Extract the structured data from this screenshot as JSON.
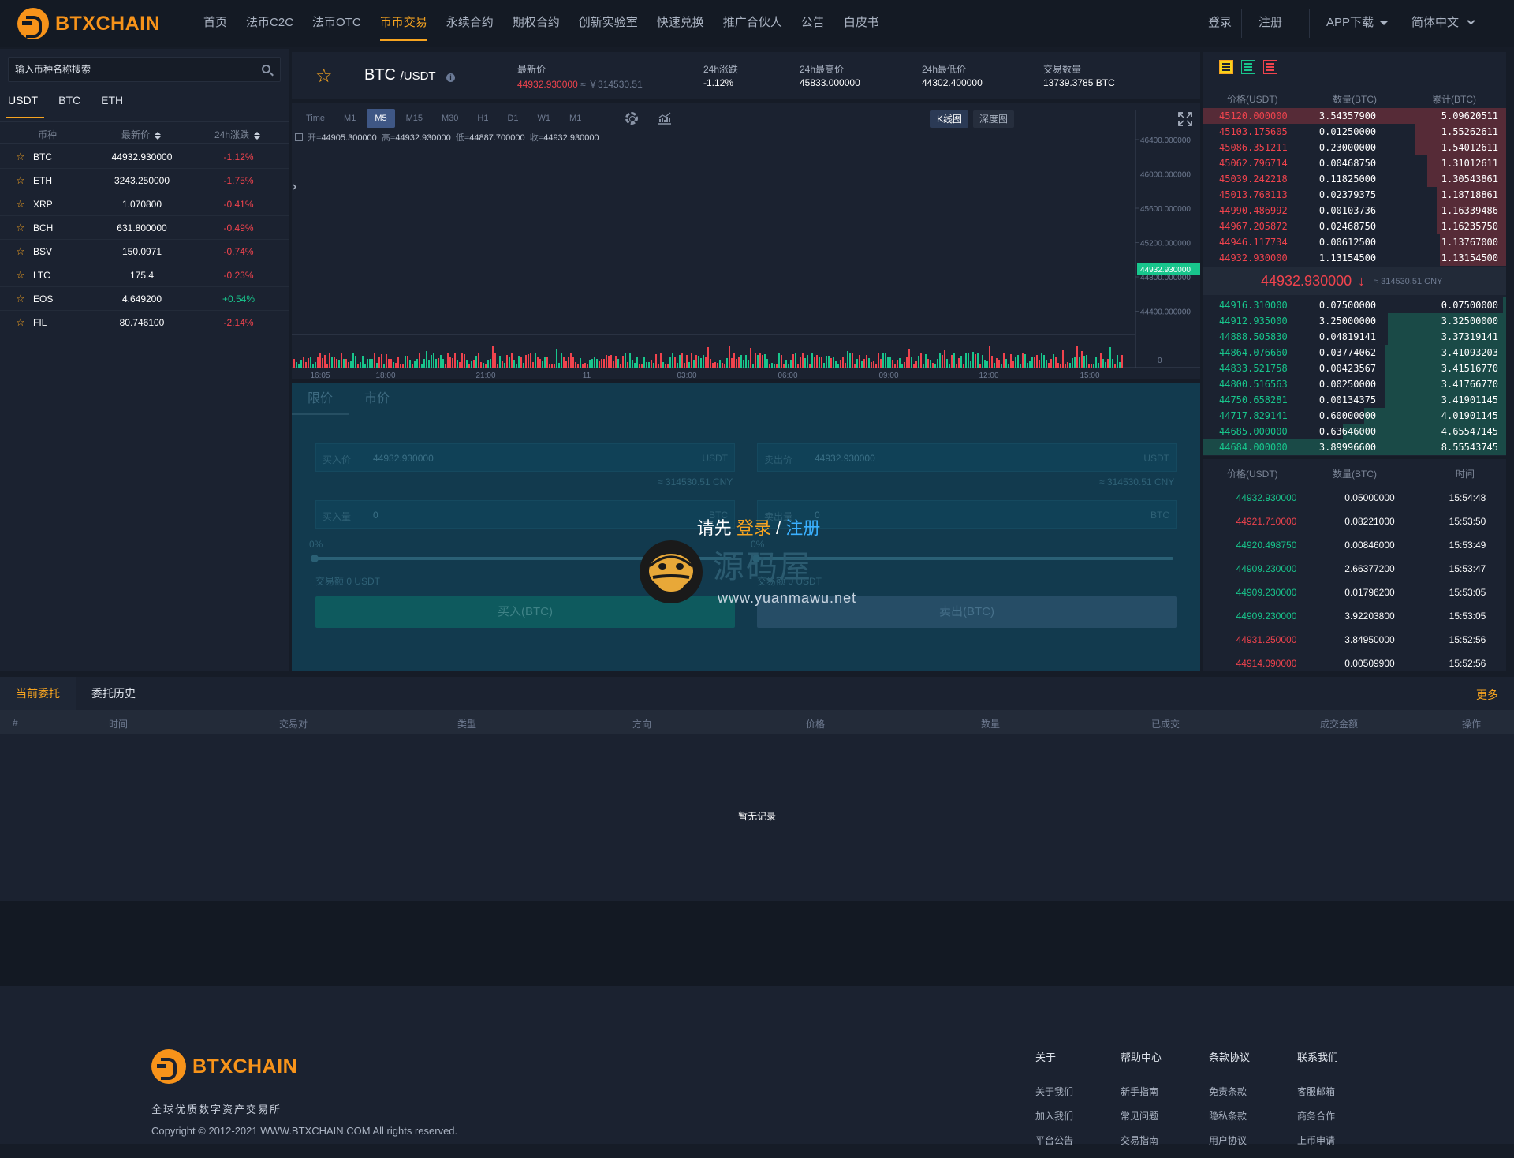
{
  "header": {
    "logo_text": "BTXCHAIN",
    "nav": [
      "首页",
      "法币C2C",
      "法币OTC",
      "币币交易",
      "永续合约",
      "期权合约",
      "创新实验室",
      "快速兑换",
      "推广合伙人",
      "公告",
      "白皮书"
    ],
    "active_nav": "币币交易",
    "login": "登录",
    "register": "注册",
    "app_download": "APP下载",
    "language": "简体中文"
  },
  "market": {
    "search_placeholder": "输入币种名称搜索",
    "tabs": [
      "USDT",
      "BTC",
      "ETH"
    ],
    "active_tab": "USDT",
    "col_coin": "币种",
    "col_price": "最新价",
    "col_change": "24h涨跌",
    "coins": [
      {
        "sym": "BTC",
        "price": "44932.930000",
        "chg": "-1.12%",
        "dir": "down"
      },
      {
        "sym": "ETH",
        "price": "3243.250000",
        "chg": "-1.75%",
        "dir": "down"
      },
      {
        "sym": "XRP",
        "price": "1.070800",
        "chg": "-0.41%",
        "dir": "down"
      },
      {
        "sym": "BCH",
        "price": "631.800000",
        "chg": "-0.49%",
        "dir": "down"
      },
      {
        "sym": "BSV",
        "price": "150.0971",
        "chg": "-0.74%",
        "dir": "down"
      },
      {
        "sym": "LTC",
        "price": "175.4",
        "chg": "-0.23%",
        "dir": "down"
      },
      {
        "sym": "EOS",
        "price": "4.649200",
        "chg": "+0.54%",
        "dir": "up"
      },
      {
        "sym": "FIL",
        "price": "80.746100",
        "chg": "-2.14%",
        "dir": "down"
      }
    ]
  },
  "ticker": {
    "base": "BTC",
    "quote": "/USDT",
    "last_label": "最新价",
    "last_price": "44932.930000",
    "last_cny": "≈ ￥314530.51",
    "change_label": "24h涨跌",
    "change": "-1.12%",
    "high_label": "24h最高价",
    "high": "45833.000000",
    "low_label": "24h最低价",
    "low": "44302.400000",
    "volume_label": "交易数量",
    "volume": "13739.3785 BTC"
  },
  "chart": {
    "intervals": [
      "Time",
      "M1",
      "M5",
      "M15",
      "M30",
      "H1",
      "D1",
      "W1",
      "M1"
    ],
    "active_interval": "M5",
    "view_kline": "K线图",
    "view_depth": "深度图",
    "ohlc": {
      "o_label": "开=",
      "o": "44905.300000",
      "h_label": "高=",
      "h": "44932.930000",
      "l_label": "低=",
      "l": "44887.700000",
      "c_label": "收=",
      "c": "44932.930000"
    },
    "price_ticks": [
      "46400.000000",
      "46000.000000",
      "45600.000000",
      "45200.000000",
      "44800.000000",
      "44400.000000"
    ],
    "current_price_tag": "44932.930000",
    "volume_zero": "0",
    "time_ticks": [
      "16:05",
      "18:00",
      "21:00",
      "11",
      "03:00",
      "06:00",
      "09:00",
      "12:00",
      "15:00"
    ],
    "colors": {
      "up": "#18c58c",
      "down": "#f0434d"
    }
  },
  "trade": {
    "tabs": [
      "限价",
      "市价"
    ],
    "buy_price_label": "买入价",
    "buy_price": "44932.930000",
    "sell_price_label": "卖出价",
    "sell_price": "44932.930000",
    "unit_usdt": "USDT",
    "unit_btc": "BTC",
    "cny_hint": "≈ 314530.51 CNY",
    "buy_amount_label": "买入量",
    "sell_amount_label": "卖出量",
    "amount": "0",
    "pct": "0%",
    "buy_total": "交易额 0 USDT",
    "sell_total": "交易额 0 USDT",
    "buy_button": "买入(BTC)",
    "sell_button": "卖出(BTC)",
    "login_prompt": "请先",
    "login_link": "登录",
    "slash": "/",
    "register_link": "注册",
    "watermark_cn": "源码屋",
    "watermark_url": "www.yuanmawu.net"
  },
  "book": {
    "col_price": "价格(USDT)",
    "col_amount": "数量(BTC)",
    "col_total": "累计(BTC)",
    "asks": [
      {
        "p": "45120.000000",
        "a": "3.54357900",
        "t": "5.09620511",
        "depth": 1.0
      },
      {
        "p": "45103.175605",
        "a": "0.01250000",
        "t": "1.55262611",
        "depth": 0.3
      },
      {
        "p": "45086.351211",
        "a": "0.23000000",
        "t": "1.54012611",
        "depth": 0.3
      },
      {
        "p": "45062.796714",
        "a": "0.00468750",
        "t": "1.31012611",
        "depth": 0.26
      },
      {
        "p": "45039.242218",
        "a": "0.11825000",
        "t": "1.30543861",
        "depth": 0.26
      },
      {
        "p": "45013.768113",
        "a": "0.02379375",
        "t": "1.18718861",
        "depth": 0.23
      },
      {
        "p": "44990.486992",
        "a": "0.00103736",
        "t": "1.16339486",
        "depth": 0.23
      },
      {
        "p": "44967.205872",
        "a": "0.02468750",
        "t": "1.16235750",
        "depth": 0.23
      },
      {
        "p": "44946.117734",
        "a": "0.00612500",
        "t": "1.13767000",
        "depth": 0.22
      },
      {
        "p": "44932.930000",
        "a": "1.13154500",
        "t": "1.13154500",
        "depth": 0.22
      }
    ],
    "mid_price": "44932.930000",
    "mid_arrow": "↓",
    "mid_cny": "≈ 314530.51 CNY",
    "bids": [
      {
        "p": "44916.310000",
        "a": "0.07500000",
        "t": "0.07500000",
        "depth": 0.01
      },
      {
        "p": "44912.935000",
        "a": "3.25000000",
        "t": "3.32500000",
        "depth": 0.39
      },
      {
        "p": "44888.505830",
        "a": "0.04819141",
        "t": "3.37319141",
        "depth": 0.39
      },
      {
        "p": "44864.076660",
        "a": "0.03774062",
        "t": "3.41093203",
        "depth": 0.4
      },
      {
        "p": "44833.521758",
        "a": "0.00423567",
        "t": "3.41516770",
        "depth": 0.4
      },
      {
        "p": "44800.516563",
        "a": "0.00250000",
        "t": "3.41766770",
        "depth": 0.4
      },
      {
        "p": "44750.658281",
        "a": "0.00134375",
        "t": "3.41901145",
        "depth": 0.4
      },
      {
        "p": "44717.829141",
        "a": "0.60000000",
        "t": "4.01901145",
        "depth": 0.47
      },
      {
        "p": "44685.000000",
        "a": "0.63646000",
        "t": "4.65547145",
        "depth": 0.54
      },
      {
        "p": "44684.000000",
        "a": "3.89996600",
        "t": "8.55543745",
        "depth": 1.0
      }
    ]
  },
  "trades": {
    "col_price": "价格(USDT)",
    "col_amount": "数量(BTC)",
    "col_time": "时间",
    "rows": [
      {
        "p": "44932.930000",
        "a": "0.05000000",
        "tm": "15:54:48",
        "dir": "up"
      },
      {
        "p": "44921.710000",
        "a": "0.08221000",
        "tm": "15:53:50",
        "dir": "down"
      },
      {
        "p": "44920.498750",
        "a": "0.00846000",
        "tm": "15:53:49",
        "dir": "up"
      },
      {
        "p": "44909.230000",
        "a": "2.66377200",
        "tm": "15:53:47",
        "dir": "up"
      },
      {
        "p": "44909.230000",
        "a": "0.01796200",
        "tm": "15:53:05",
        "dir": "up"
      },
      {
        "p": "44909.230000",
        "a": "3.92203800",
        "tm": "15:53:05",
        "dir": "up"
      },
      {
        "p": "44931.250000",
        "a": "3.84950000",
        "tm": "15:52:56",
        "dir": "down"
      },
      {
        "p": "44914.090000",
        "a": "0.00509900",
        "tm": "15:52:56",
        "dir": "down"
      }
    ]
  },
  "orders": {
    "tabs": [
      "当前委托",
      "委托历史"
    ],
    "more": "更多",
    "cols": [
      "#",
      "时间",
      "交易对",
      "类型",
      "方向",
      "价格",
      "数量",
      "已成交",
      "成交金额",
      "操作"
    ],
    "empty": "暂无记录"
  },
  "footer": {
    "logo_text": "BTXCHAIN",
    "slogan": "全球优质数字资产交易所",
    "copyright": "Copyright © 2012-2021 WWW.BTXCHAIN.COM All rights reserved.",
    "cols": [
      {
        "h": "关于",
        "links": [
          "关于我们",
          "加入我们",
          "平台公告"
        ]
      },
      {
        "h": "帮助中心",
        "links": [
          "新手指南",
          "常见问题",
          "交易指南"
        ]
      },
      {
        "h": "条款协议",
        "links": [
          "免责条款",
          "隐私条款",
          "用户协议"
        ]
      },
      {
        "h": "联系我们",
        "links": [
          "客服邮箱",
          "商务合作",
          "上币申请"
        ]
      }
    ]
  }
}
